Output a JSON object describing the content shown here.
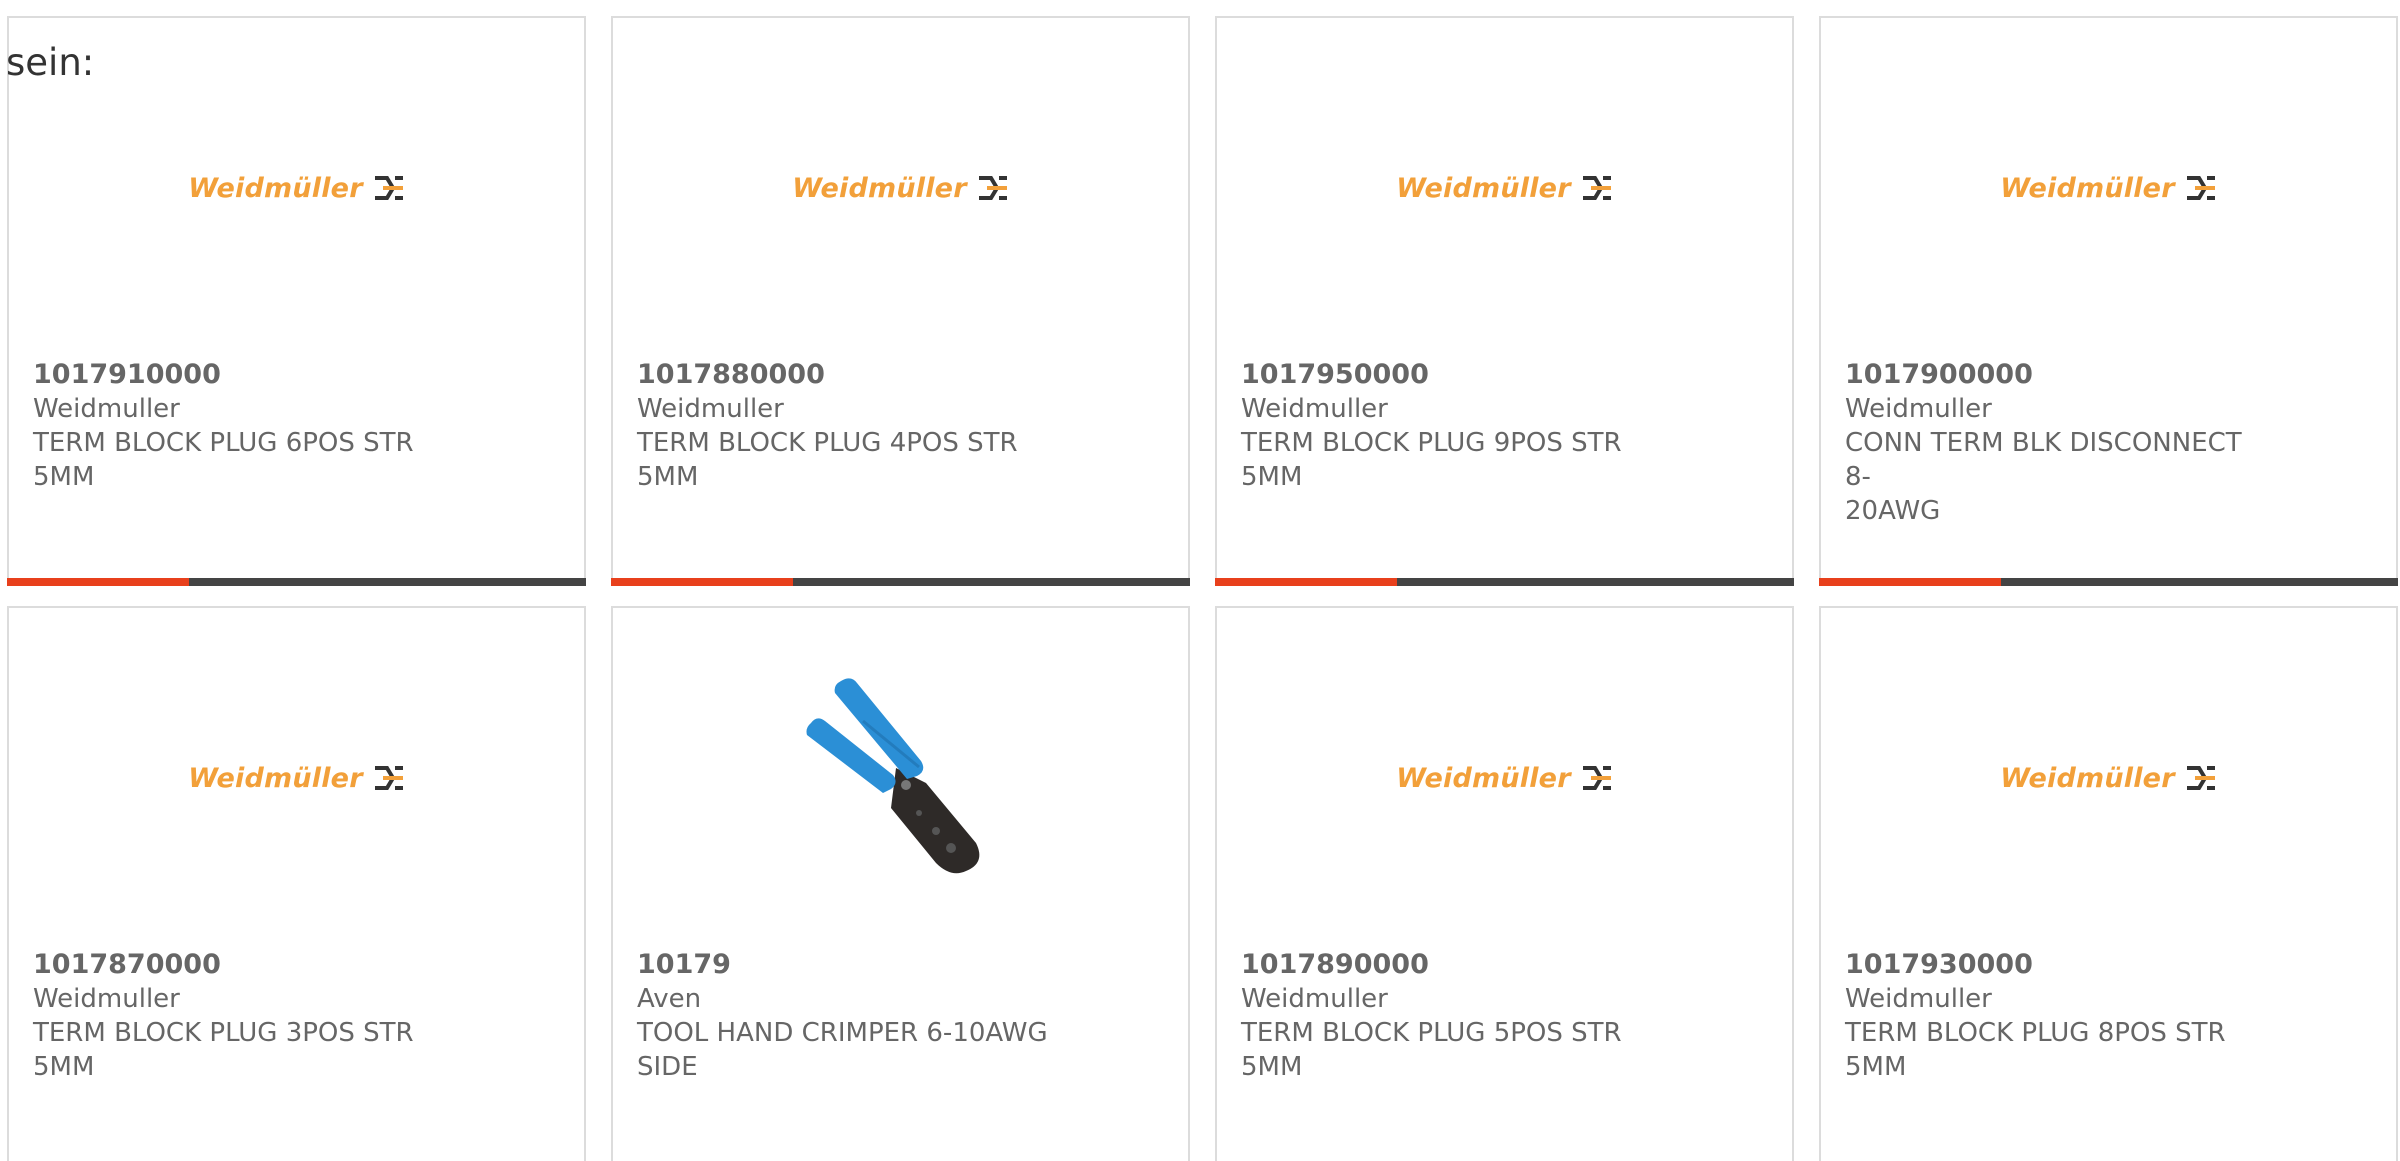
{
  "intro_text": "sein:",
  "colors": {
    "accent": "#e8401c",
    "bar": "#444444",
    "logo": "#f2a03a",
    "tool_handle": "#2b8fd6"
  },
  "products": [
    {
      "part": "1017910000",
      "manufacturer": "Weidmuller",
      "desc_line1": "TERM BLOCK PLUG 6POS STR",
      "desc_line2": "5MM",
      "image": "weidmuller-logo",
      "logo_text": "Weidmüller"
    },
    {
      "part": "1017880000",
      "manufacturer": "Weidmuller",
      "desc_line1": "TERM BLOCK PLUG 4POS STR",
      "desc_line2": "5MM",
      "image": "weidmuller-logo",
      "logo_text": "Weidmüller"
    },
    {
      "part": "1017950000",
      "manufacturer": "Weidmuller",
      "desc_line1": "TERM BLOCK PLUG 9POS STR",
      "desc_line2": "5MM",
      "image": "weidmuller-logo",
      "logo_text": "Weidmüller"
    },
    {
      "part": "1017900000",
      "manufacturer": "Weidmuller",
      "desc_line1": "CONN TERM BLK DISCONNECT 8-",
      "desc_line2": "20AWG",
      "image": "weidmuller-logo",
      "logo_text": "Weidmüller"
    },
    {
      "part": "1017870000",
      "manufacturer": "Weidmuller",
      "desc_line1": "TERM BLOCK PLUG 3POS STR",
      "desc_line2": "5MM",
      "image": "weidmuller-logo",
      "logo_text": "Weidmüller"
    },
    {
      "part": "10179",
      "manufacturer": "Aven",
      "desc_line1": "TOOL HAND CRIMPER 6-10AWG",
      "desc_line2": "SIDE",
      "image": "crimper-tool-photo"
    },
    {
      "part": "1017890000",
      "manufacturer": "Weidmuller",
      "desc_line1": "TERM BLOCK PLUG 5POS STR",
      "desc_line2": "5MM",
      "image": "weidmuller-logo",
      "logo_text": "Weidmüller"
    },
    {
      "part": "1017930000",
      "manufacturer": "Weidmuller",
      "desc_line1": "TERM BLOCK PLUG 8POS STR",
      "desc_line2": "5MM",
      "image": "weidmuller-logo",
      "logo_text": "Weidmüller"
    }
  ]
}
